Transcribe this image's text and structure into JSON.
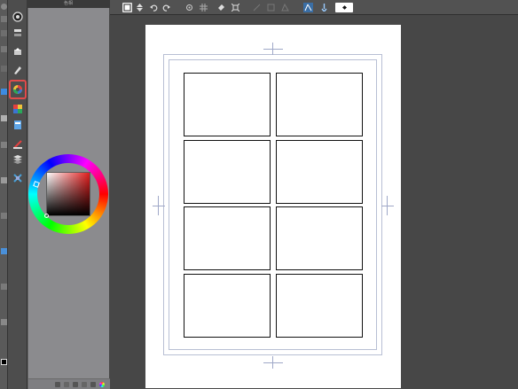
{
  "panel_title": "色相",
  "toolbar": {
    "tools": [
      "zoom-icon",
      "move-icon",
      "select-icon",
      "eyedropper-icon",
      "pen-icon",
      "brush-icon",
      "eraser-icon",
      "fill-icon",
      "gradient-icon",
      "figure-icon",
      "text-icon",
      "balloon-icon",
      "line-icon"
    ]
  },
  "subtools": {
    "items": [
      "view-icon",
      "layer-icon",
      "layer-move-icon",
      "pen-tool-icon",
      "color-palette-icon",
      "color-set-icon",
      "layer-stack-icon",
      "ruler-icon",
      "layers-icon",
      "transform-icon"
    ],
    "selected": "color-palette-icon"
  },
  "command_bar": {
    "items": [
      "new-icon",
      "transform-toggle-icon",
      "undo-icon",
      "redo-icon",
      "snap-icon",
      "grid-icon",
      "fill-icon",
      "fit-icon",
      "ruler-icon",
      "ruler2-icon",
      "ruler3-icon",
      "perspective-icon",
      "pen-icon",
      "help-icon"
    ]
  },
  "colors": {
    "accent_selection": "#e14b4b",
    "hue_current": "#e21d1d",
    "main_color": "#000000",
    "canvas_background": "#474747",
    "paper": "#ffffff"
  },
  "page": {
    "panel_count": 8,
    "columns": 2,
    "rows": 4
  }
}
